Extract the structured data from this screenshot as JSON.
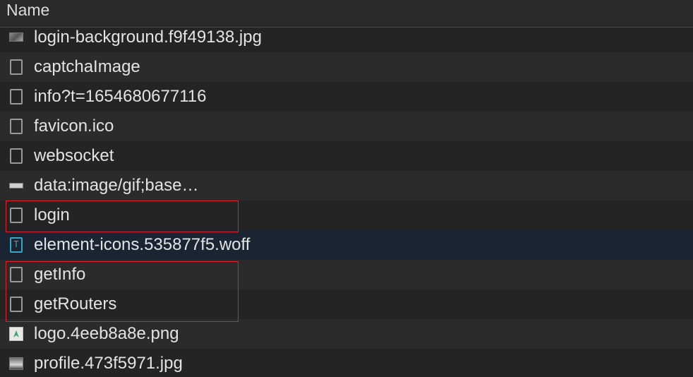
{
  "header": {
    "column_name": "Name"
  },
  "rows": [
    {
      "name": "login-background.f9f49138.jpg",
      "icon": "image-file-icon"
    },
    {
      "name": "captchaImage",
      "icon": "document-icon"
    },
    {
      "name": "info?t=1654680677116",
      "icon": "document-icon"
    },
    {
      "name": "favicon.ico",
      "icon": "document-icon"
    },
    {
      "name": "websocket",
      "icon": "document-icon"
    },
    {
      "name": "data:image/gif;base…",
      "icon": "image-file-icon"
    },
    {
      "name": "login",
      "icon": "document-icon"
    },
    {
      "name": "element-icons.535877f5.woff",
      "icon": "font-file-icon",
      "icon_glyph": "T"
    },
    {
      "name": "getInfo",
      "icon": "document-icon"
    },
    {
      "name": "getRouters",
      "icon": "document-icon"
    },
    {
      "name": "logo.4eeb8a8e.png",
      "icon": "image-file-icon"
    },
    {
      "name": "profile.473f5971.jpg",
      "icon": "image-file-icon"
    }
  ],
  "colors": {
    "background": "#242424",
    "row_alt": "#2b2b2b",
    "selected_row": "#1b2433",
    "text": "#e3e3e3",
    "highlight_box": "#e0212b",
    "font_icon": "#3aa7c9"
  }
}
